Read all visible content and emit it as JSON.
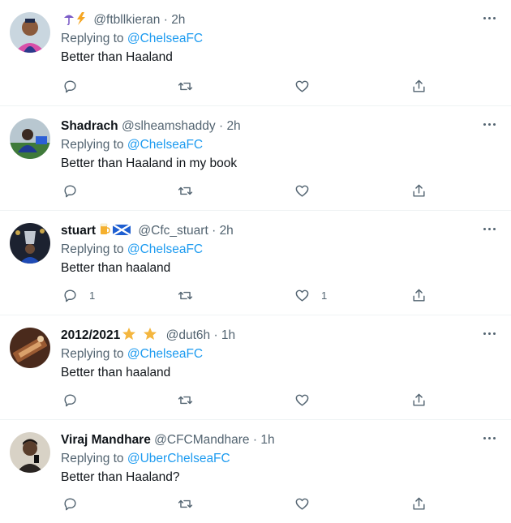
{
  "tweets": [
    {
      "name": "",
      "name_emoji": "☂⚡",
      "handle": "@ftbllkieran",
      "time": "2h",
      "replying_label": "Replying to",
      "replying_to": "@ChelseaFC",
      "text": "Better than Haaland",
      "reply_count": "",
      "like_count": ""
    },
    {
      "name": "Shadrach",
      "name_emoji": "",
      "handle": "@slheamshaddy",
      "time": "2h",
      "replying_label": "Replying to",
      "replying_to": "@ChelseaFC",
      "text": "Better than Haaland in my book",
      "reply_count": "",
      "like_count": ""
    },
    {
      "name": "stuart",
      "name_emoji": "🍺🏴",
      "handle": "@Cfc_stuart",
      "time": "2h",
      "replying_label": "Replying to",
      "replying_to": "@ChelseaFC",
      "text": "Better than haaland",
      "reply_count": "1",
      "like_count": "1"
    },
    {
      "name": "2012/2021",
      "name_emoji": "★ ★",
      "handle": "@dut6h",
      "time": "1h",
      "replying_label": "Replying to",
      "replying_to": "@ChelseaFC",
      "text": "Better than haaland",
      "reply_count": "",
      "like_count": ""
    },
    {
      "name": "Viraj Mandhare",
      "name_emoji": "",
      "handle": "@CFCMandhare",
      "time": "1h",
      "replying_label": "Replying to",
      "replying_to": "@UberChelseaFC",
      "text": "Better than Haaland?",
      "reply_count": "",
      "like_count": ""
    }
  ],
  "separator": "·",
  "colors": {
    "text": "#0f1419",
    "muted": "#536471",
    "link": "#1d9bf0",
    "star": "#f4b63f"
  }
}
